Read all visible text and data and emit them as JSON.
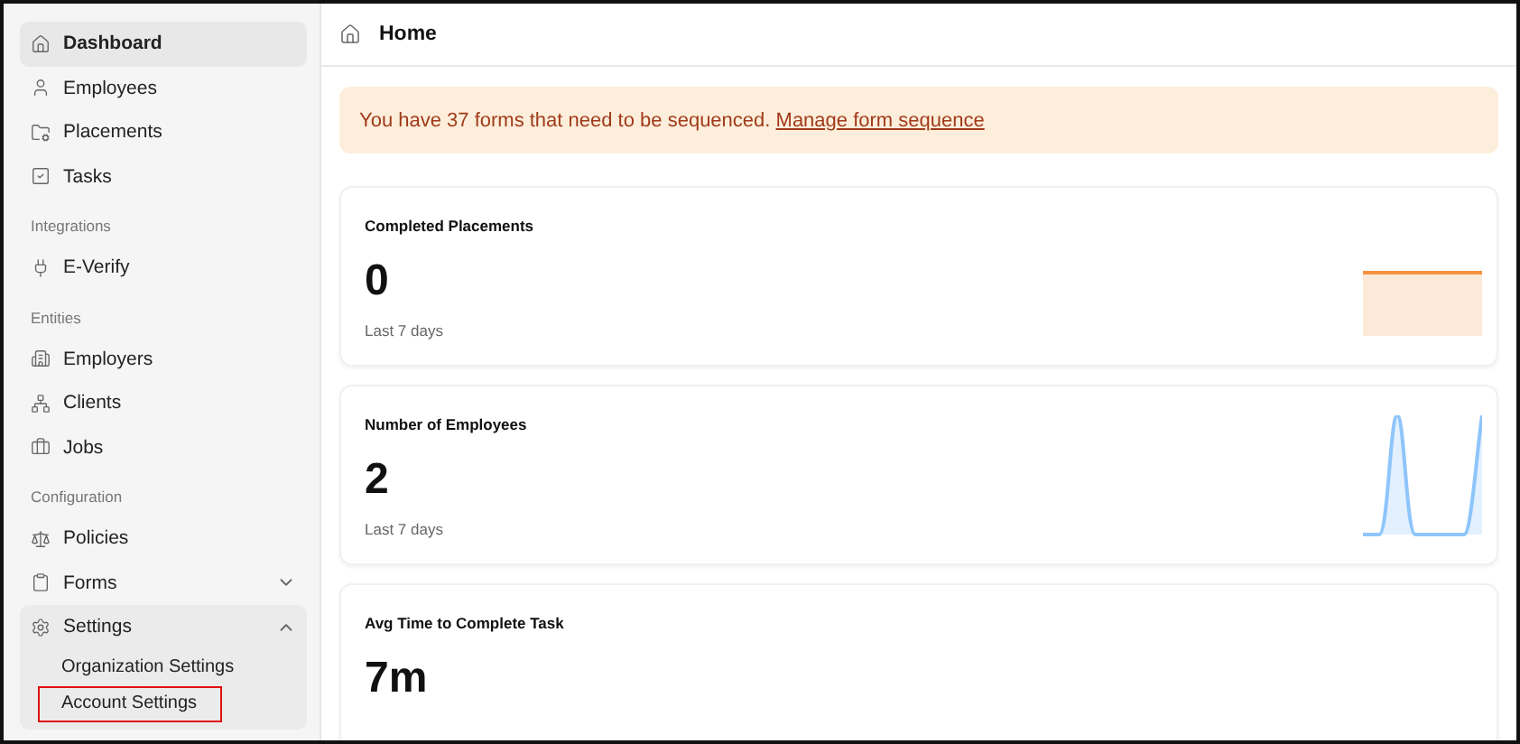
{
  "sidebar": {
    "groups": [
      {
        "items": [
          {
            "label": "Dashboard",
            "selected": true
          },
          {
            "label": "Employees",
            "selected": false
          },
          {
            "label": "Placements",
            "selected": false
          },
          {
            "label": "Tasks",
            "selected": false
          }
        ]
      },
      {
        "heading": "Integrations",
        "items": [
          {
            "label": "E-Verify",
            "selected": false
          }
        ]
      },
      {
        "heading": "Entities",
        "items": [
          {
            "label": "Employers",
            "selected": false
          },
          {
            "label": "Clients",
            "selected": false
          },
          {
            "label": "Jobs",
            "selected": false
          }
        ]
      },
      {
        "heading": "Configuration",
        "items": [
          {
            "label": "Policies",
            "selected": false
          },
          {
            "label": "Forms",
            "selected": false,
            "expanded": false
          },
          {
            "label": "Settings",
            "selected": false,
            "expanded": true,
            "children": [
              {
                "label": "Organization Settings",
                "highlighted": false
              },
              {
                "label": "Account Settings",
                "highlighted": true
              }
            ]
          }
        ]
      }
    ]
  },
  "header": {
    "title": "Home"
  },
  "banner": {
    "text": "You have 37 forms that need to be sequenced.",
    "link": "Manage form sequence"
  },
  "cards": [
    {
      "title": "Completed Placements",
      "value": "0",
      "caption": "Last 7 days",
      "kind": "flat",
      "color": "#f5923e"
    },
    {
      "title": "Number of Employees",
      "value": "2",
      "caption": "Last 7 days",
      "kind": "peaks",
      "color": "#8ec5fb"
    },
    {
      "title": "Avg Time to Complete Task",
      "value": "7m"
    }
  ]
}
